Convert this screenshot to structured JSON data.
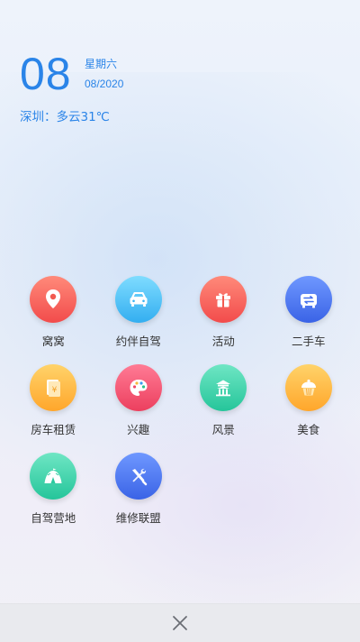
{
  "header": {
    "day": "08",
    "weekday": "星期六",
    "month_year": "08/2020",
    "weather": "深圳：多云31℃"
  },
  "colors": {
    "accent": "#2a84e8"
  },
  "menu": {
    "items": [
      {
        "label": "窝窝",
        "icon": "location-pin-icon"
      },
      {
        "label": "约伴自驾",
        "icon": "car-icon"
      },
      {
        "label": "活动",
        "icon": "gift-icon"
      },
      {
        "label": "二手车",
        "icon": "car-exchange-icon"
      },
      {
        "label": "房车租赁",
        "icon": "rental-document-icon"
      },
      {
        "label": "兴趣",
        "icon": "palette-icon"
      },
      {
        "label": "风景",
        "icon": "pavilion-icon"
      },
      {
        "label": "美食",
        "icon": "cupcake-icon"
      },
      {
        "label": "自驾营地",
        "icon": "tent-icon"
      },
      {
        "label": "维修联盟",
        "icon": "wrench-screwdriver-icon"
      }
    ]
  },
  "footer": {
    "close_icon": "close-icon"
  }
}
